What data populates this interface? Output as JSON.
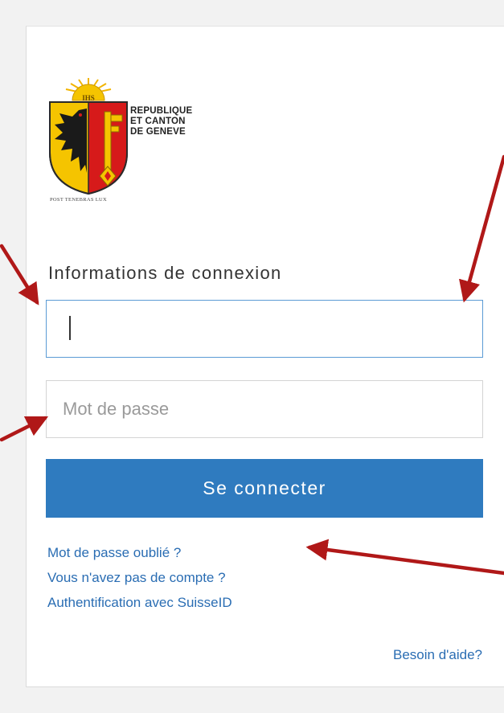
{
  "logo": {
    "line1": "REPUBLIQUE",
    "line2": "ET CANTON",
    "line3": "DE GENEVE",
    "motto": "POST TENEBRAS LUX",
    "sun_text": "IHS"
  },
  "login": {
    "title": "Informations de connexion",
    "username_value": "",
    "password_placeholder": "Mot de passe",
    "submit_label": "Se connecter"
  },
  "links": {
    "forgot_password": "Mot de passe oublié ?",
    "no_account": "Vous n'avez pas de compte ?",
    "suisseid": "Authentification avec SuisseID",
    "help": "Besoin d'aide?"
  },
  "colors": {
    "button": "#2f7bbf",
    "link": "#2a6db3",
    "active_border": "#5b9bd5",
    "annotation_arrow": "#b01818"
  }
}
